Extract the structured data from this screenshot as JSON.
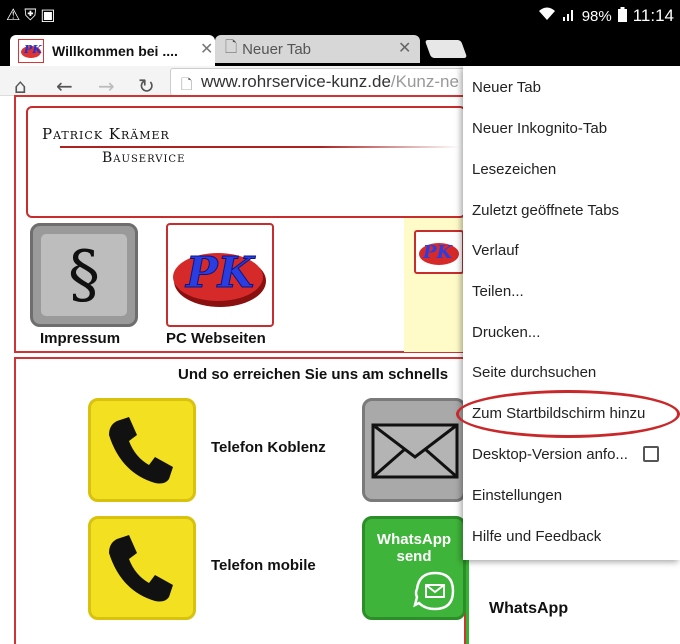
{
  "status_bar": {
    "left_icons": [
      "warning-icon",
      "shield-icon",
      "screenshot-icon"
    ],
    "battery": "98%",
    "time": "11:14"
  },
  "tabs": [
    {
      "title": "Willkommen bei ....",
      "active": true
    },
    {
      "title": "Neuer Tab",
      "active": false
    }
  ],
  "toolbar": {
    "url_main": "www.rohrservice-kunz.de",
    "url_rest": "/Kunz-ne"
  },
  "page": {
    "logo_name": "Patrick Krämer",
    "logo_sub": "Bauservice",
    "section_symbol": "§",
    "tile_impressum_label": "Impressum",
    "tile_pc_label": "PC Webseiten",
    "pk_text": "PK",
    "reach_title": "Und so erreichen Sie uns am schnells",
    "contact_koblenz": "Telefon Koblenz",
    "contact_mobile": "Telefon mobile",
    "whatsapp_line1": "WhatsApp",
    "whatsapp_line2": "send",
    "whatsapp_card": "WhatsApp"
  },
  "menu": {
    "items": [
      "Neuer Tab",
      "Neuer Inkognito-Tab",
      "Lesezeichen",
      "Zuletzt geöffnete Tabs",
      "Verlauf",
      "Teilen...",
      "Drucken...",
      "Seite durchsuchen",
      "Zum Startbildschirm hinzu",
      "Desktop-Version anfo...",
      "Einstellungen",
      "Hilfe und Feedback"
    ],
    "highlighted_item": "Zum Startbildschirm hinzu"
  },
  "colors": {
    "accent_red": "#c72d2d",
    "phone_yellow": "#f3e021",
    "whatsapp_green": "#3fb43a"
  }
}
